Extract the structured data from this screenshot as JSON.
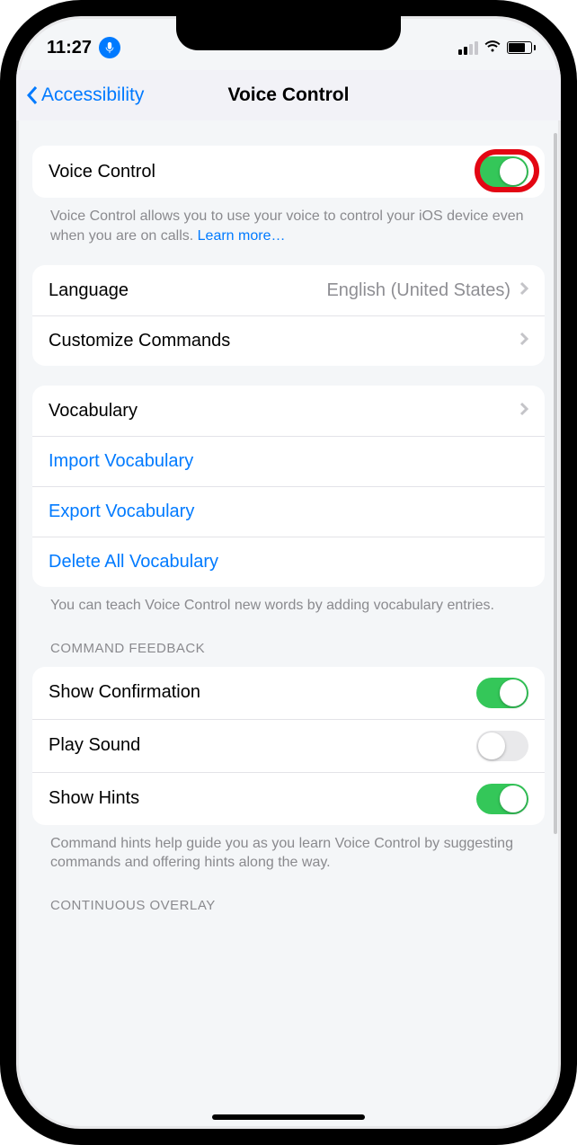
{
  "status": {
    "time": "11:27"
  },
  "nav": {
    "back": "Accessibility",
    "title": "Voice Control"
  },
  "main_toggle": {
    "label": "Voice Control",
    "on": true
  },
  "main_footer": {
    "text": "Voice Control allows you to use your voice to control your iOS device even when you are on calls. ",
    "link": "Learn more…"
  },
  "lang_group": {
    "language_label": "Language",
    "language_value": "English (United States)",
    "customize_label": "Customize Commands"
  },
  "vocab_group": {
    "vocabulary": "Vocabulary",
    "import": "Import Vocabulary",
    "export": "Export Vocabulary",
    "delete": "Delete All Vocabulary"
  },
  "vocab_footer": "You can teach Voice Control new words by adding vocabulary entries.",
  "feedback_header": "COMMAND FEEDBACK",
  "feedback": {
    "confirm_label": "Show Confirmation",
    "confirm_on": true,
    "sound_label": "Play Sound",
    "sound_on": false,
    "hints_label": "Show Hints",
    "hints_on": true
  },
  "feedback_footer": "Command hints help guide you as you learn Voice Control by suggesting commands and offering hints along the way.",
  "overlay_header": "CONTINUOUS OVERLAY"
}
